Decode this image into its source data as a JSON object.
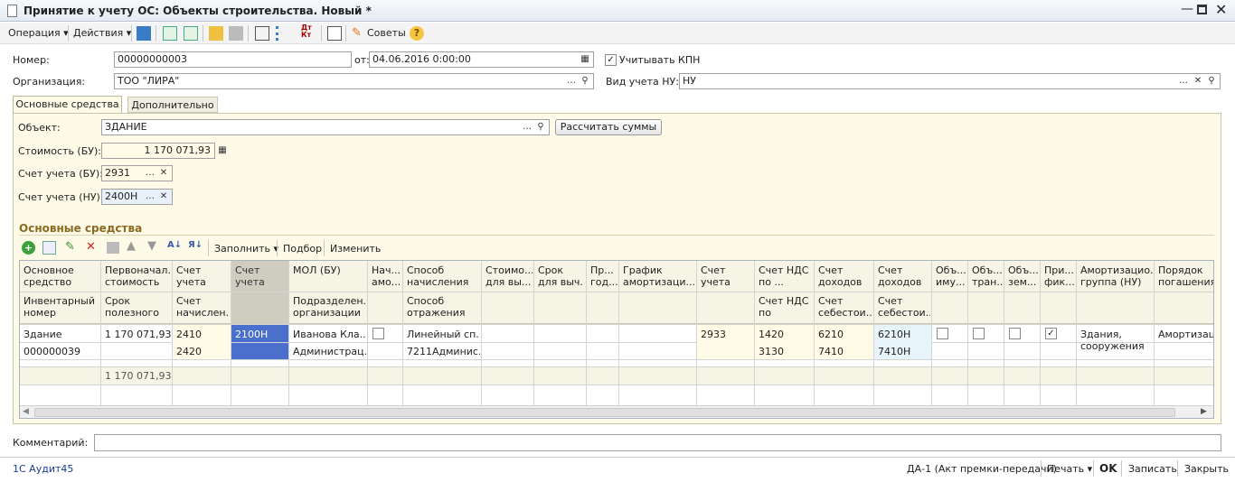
{
  "window": {
    "title": "Принятие к учету ОС: Объекты строительства. Новый *"
  },
  "toolbar": {
    "operation": "Операция",
    "actions": "Действия",
    "tips": "Советы"
  },
  "header": {
    "number_label": "Номер:",
    "number_value": "00000000003",
    "date_label": "от:",
    "date_value": "04.06.2016  0:00:00",
    "kpn_label": "Учитывать КПН",
    "org_label": "Организация:",
    "org_value": "ТОО \"ЛИРА\"",
    "nu_label": "Вид учета НУ:",
    "nu_value": "НУ"
  },
  "tabs": [
    "Основные средства",
    "Дополнительно"
  ],
  "main": {
    "object_label": "Объект:",
    "object_value": "ЗДАНИЕ",
    "calc_button": "Рассчитать суммы",
    "cost_label": "Стоимость (БУ):",
    "cost_value": "1 170 071,93",
    "acc_bu_label": "Счет учета (БУ):",
    "acc_bu_value": "2931",
    "acc_nu_label": "Счет учета (НУ):",
    "acc_nu_value": "2400Н"
  },
  "section_title": "Основные средства",
  "table_toolbar": {
    "fill": "Заполнить",
    "select": "Подбор",
    "change": "Изменить"
  },
  "table": {
    "head_top": [
      "Основное средство",
      "Первоначал... стоимость ...",
      "Счет учета (БУ)",
      "Счет учета (НУ)",
      "МОЛ (БУ)",
      "Нач... амо...",
      "Способ начисления ...",
      "Стоимо... для вы...",
      "Срок для выч. ...",
      "Пр... год...",
      "График амортизаци...",
      "Счет учета затрат п...",
      "Счет НДС по ...",
      "Счет доходов от",
      "Счет доходов от",
      "Объ... иму...",
      "Объ... тран...",
      "Объ... зем...",
      "При... фик...",
      "Амортизацио... группа (НУ)",
      "Порядок погашения ..."
    ],
    "head_bottom": [
      "Инвентарный номер",
      "Срок полезного",
      "Счет начислен...",
      "",
      "Подразделен... организации",
      "",
      "Способ отражения",
      "",
      "",
      "",
      "",
      "",
      "Счет НДС по",
      "Счет себестои...",
      "Счет себестои...",
      "",
      "",
      "",
      "",
      "",
      ""
    ],
    "row_top": [
      "Здание",
      "1 170 071,93",
      "2410",
      "2100Н",
      "Иванова Кла...",
      "",
      "Линейный сп...",
      "",
      "",
      "",
      "",
      "2933",
      "1420",
      "6210",
      "6210Н",
      "",
      "",
      "",
      "",
      "Здания, сооружения ...",
      "Амортизаци..."
    ],
    "row_bottom": [
      "000000039",
      "",
      "2420",
      "",
      "Администрац...",
      "",
      "7211Админис...",
      "",
      "",
      "",
      "",
      "",
      "3130",
      "7410",
      "7410Н",
      "",
      "",
      "",
      "",
      "",
      ""
    ],
    "totals": [
      "",
      "1 170 071,93"
    ]
  },
  "comment_label": "Комментарий:",
  "footer": {
    "brand": "1С Аудит45",
    "doc": "ДА-1 (Акт премки-передачи)",
    "print": "Печать",
    "ok": "OK",
    "save": "Записать",
    "close": "Закрыть"
  }
}
